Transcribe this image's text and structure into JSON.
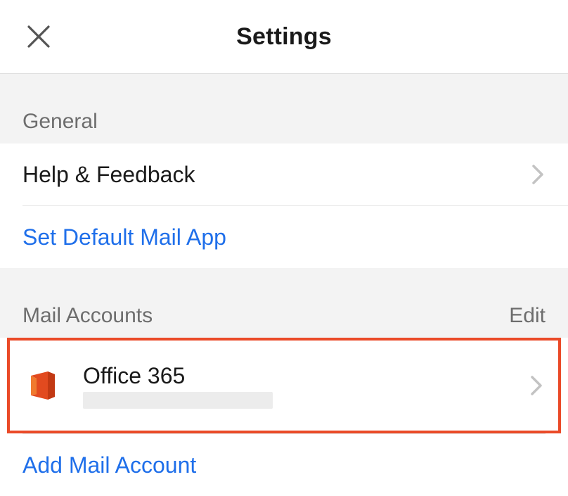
{
  "header": {
    "title": "Settings"
  },
  "sections": {
    "general": {
      "label": "General",
      "help_feedback": "Help & Feedback",
      "set_default_mail": "Set Default Mail App"
    },
    "mail_accounts": {
      "label": "Mail Accounts",
      "edit": "Edit",
      "account": {
        "name": "Office 365"
      },
      "add_account": "Add Mail Account"
    }
  }
}
